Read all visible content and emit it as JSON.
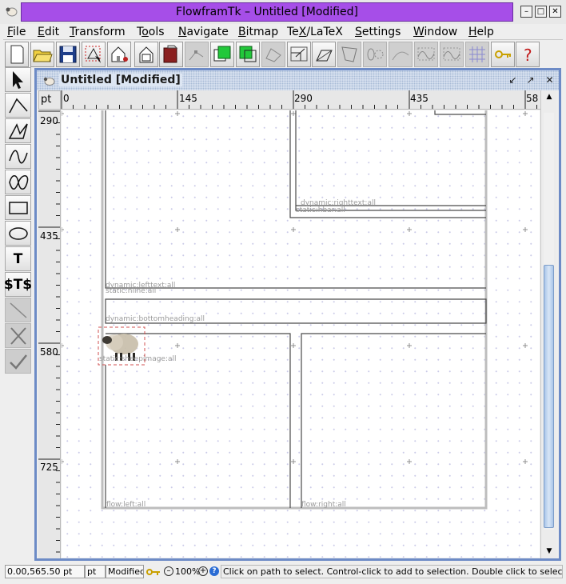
{
  "app": {
    "title": "FlowframTk – Untitled [Modified]",
    "wm_buttons": [
      "minimize-icon",
      "maximize-icon",
      "close-icon"
    ]
  },
  "menu": [
    {
      "label": "File",
      "mnemonic": "F"
    },
    {
      "label": "Edit",
      "mnemonic": "E"
    },
    {
      "label": "Transform",
      "mnemonic": "T"
    },
    {
      "label": "Tools",
      "mnemonic": "o"
    },
    {
      "label": "Navigate",
      "mnemonic": "N"
    },
    {
      "label": "Bitmap",
      "mnemonic": "B"
    },
    {
      "label": "TeX/LaTeX",
      "mnemonic": "X"
    },
    {
      "label": "Settings",
      "mnemonic": "S"
    },
    {
      "label": "Window",
      "mnemonic": "W"
    },
    {
      "label": "Help",
      "mnemonic": "H"
    }
  ],
  "toolbar": [
    {
      "name": "new-icon",
      "enabled": true
    },
    {
      "name": "open-icon",
      "enabled": true
    },
    {
      "name": "save-icon",
      "enabled": true
    },
    {
      "name": "select-all-icon",
      "enabled": true
    },
    {
      "name": "properties-icon",
      "enabled": true
    },
    {
      "name": "frame-properties-icon",
      "enabled": true
    },
    {
      "name": "book-properties-icon",
      "enabled": true
    },
    {
      "name": "edit-path-icon",
      "enabled": false
    },
    {
      "name": "move-to-front-icon",
      "enabled": true
    },
    {
      "name": "move-to-back-icon",
      "enabled": true
    },
    {
      "name": "reduce-path-icon",
      "enabled": false
    },
    {
      "name": "scale-icon",
      "enabled": true
    },
    {
      "name": "shear-icon",
      "enabled": true
    },
    {
      "name": "distort-icon",
      "enabled": false
    },
    {
      "name": "pattern-icon",
      "enabled": false
    },
    {
      "name": "text-path-icon",
      "enabled": false
    },
    {
      "name": "merge-paths-icon",
      "enabled": false
    },
    {
      "name": "split-icon",
      "enabled": false
    },
    {
      "name": "grid-icon",
      "enabled": false
    },
    {
      "name": "lock-grid-icon",
      "enabled": true
    },
    {
      "name": "help-icon",
      "enabled": true
    }
  ],
  "tools": [
    {
      "name": "select-tool-icon",
      "enabled": true
    },
    {
      "name": "open-line-tool-icon",
      "enabled": true
    },
    {
      "name": "closed-line-tool-icon",
      "enabled": true
    },
    {
      "name": "open-curve-tool-icon",
      "enabled": true
    },
    {
      "name": "closed-curve-tool-icon",
      "enabled": true
    },
    {
      "name": "rectangle-tool-icon",
      "enabled": true
    },
    {
      "name": "ellipse-tool-icon",
      "enabled": true
    },
    {
      "name": "text-tool-icon",
      "label": "T",
      "enabled": true
    },
    {
      "name": "math-text-tool-icon",
      "label": "$T$",
      "enabled": true
    },
    {
      "name": "gap-tool-icon",
      "enabled": false
    },
    {
      "name": "abandon-path-icon",
      "enabled": false
    },
    {
      "name": "finish-path-icon",
      "enabled": false
    }
  ],
  "document": {
    "title": "Untitled [Modified]",
    "ruler_unit": "pt",
    "h_ticks": [
      "0",
      "145",
      "290",
      "435",
      "58"
    ],
    "v_ticks": [
      "290",
      "435",
      "580",
      "725"
    ],
    "frame_labels": [
      "dynamic:righttext:all",
      "static:hbar:all",
      "dynamic:lefttext:all",
      "static:hline:all",
      "dynamic:bottomheading:all",
      "static:sheepimage:all",
      "flow:left:all",
      "flow:right:all"
    ]
  },
  "statusbar": {
    "position": "0.00,565.50 pt",
    "unit": "pt",
    "modified": "Modified",
    "zoom": "100%",
    "message": "Click on path to select. Control-click to add to selection. Double click to select path unde"
  },
  "colors": {
    "title_bar": "#a64ee8",
    "frame_border": "#6d8bc6",
    "grid_dot": "#c8c8e6",
    "scroll_thumb": "#a9c5e9"
  }
}
